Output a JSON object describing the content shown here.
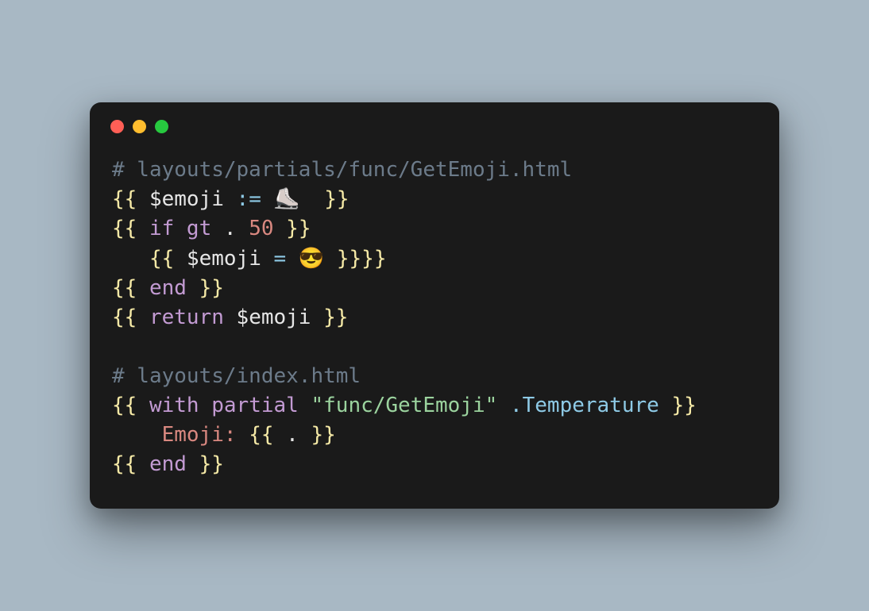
{
  "window": {
    "traffic_lights": [
      "red",
      "yellow",
      "green"
    ]
  },
  "code": {
    "lines": {
      "l1_comment": "# layouts/partials/func/GetEmoji.html",
      "l2_open": "{{ ",
      "l2_var": "$emoji",
      "l2_assign": " := ",
      "l2_emoji": "⛸️",
      "l2_close": "  }}",
      "l3_open": "{{ ",
      "l3_if": "if",
      "l3_gt": " gt ",
      "l3_dot": ".",
      "l3_num": " 50",
      "l3_close": " }}",
      "l4_indent": "   ",
      "l4_open": "{{ ",
      "l4_var": "$emoji",
      "l4_eq": " = ",
      "l4_emoji": "😎",
      "l4_close": " }}}}",
      "l5_open": "{{ ",
      "l5_end": "end",
      "l5_close": " }}",
      "l6_open": "{{ ",
      "l6_return": "return",
      "l6_var": " $emoji",
      "l6_close": " }}",
      "blank": "",
      "l7_comment": "# layouts/index.html",
      "l8_open": "{{ ",
      "l8_with": "with",
      "l8_partial": " partial ",
      "l8_str": "\"func/GetEmoji\"",
      "l8_attr": " .Temperature",
      "l8_close": " }}",
      "l9_indent": "    ",
      "l9_label": "Emoji:",
      "l9_open": " {{ ",
      "l9_dot": ".",
      "l9_close": " }}",
      "l10_open": "{{ ",
      "l10_end": "end",
      "l10_close": " }}"
    }
  }
}
